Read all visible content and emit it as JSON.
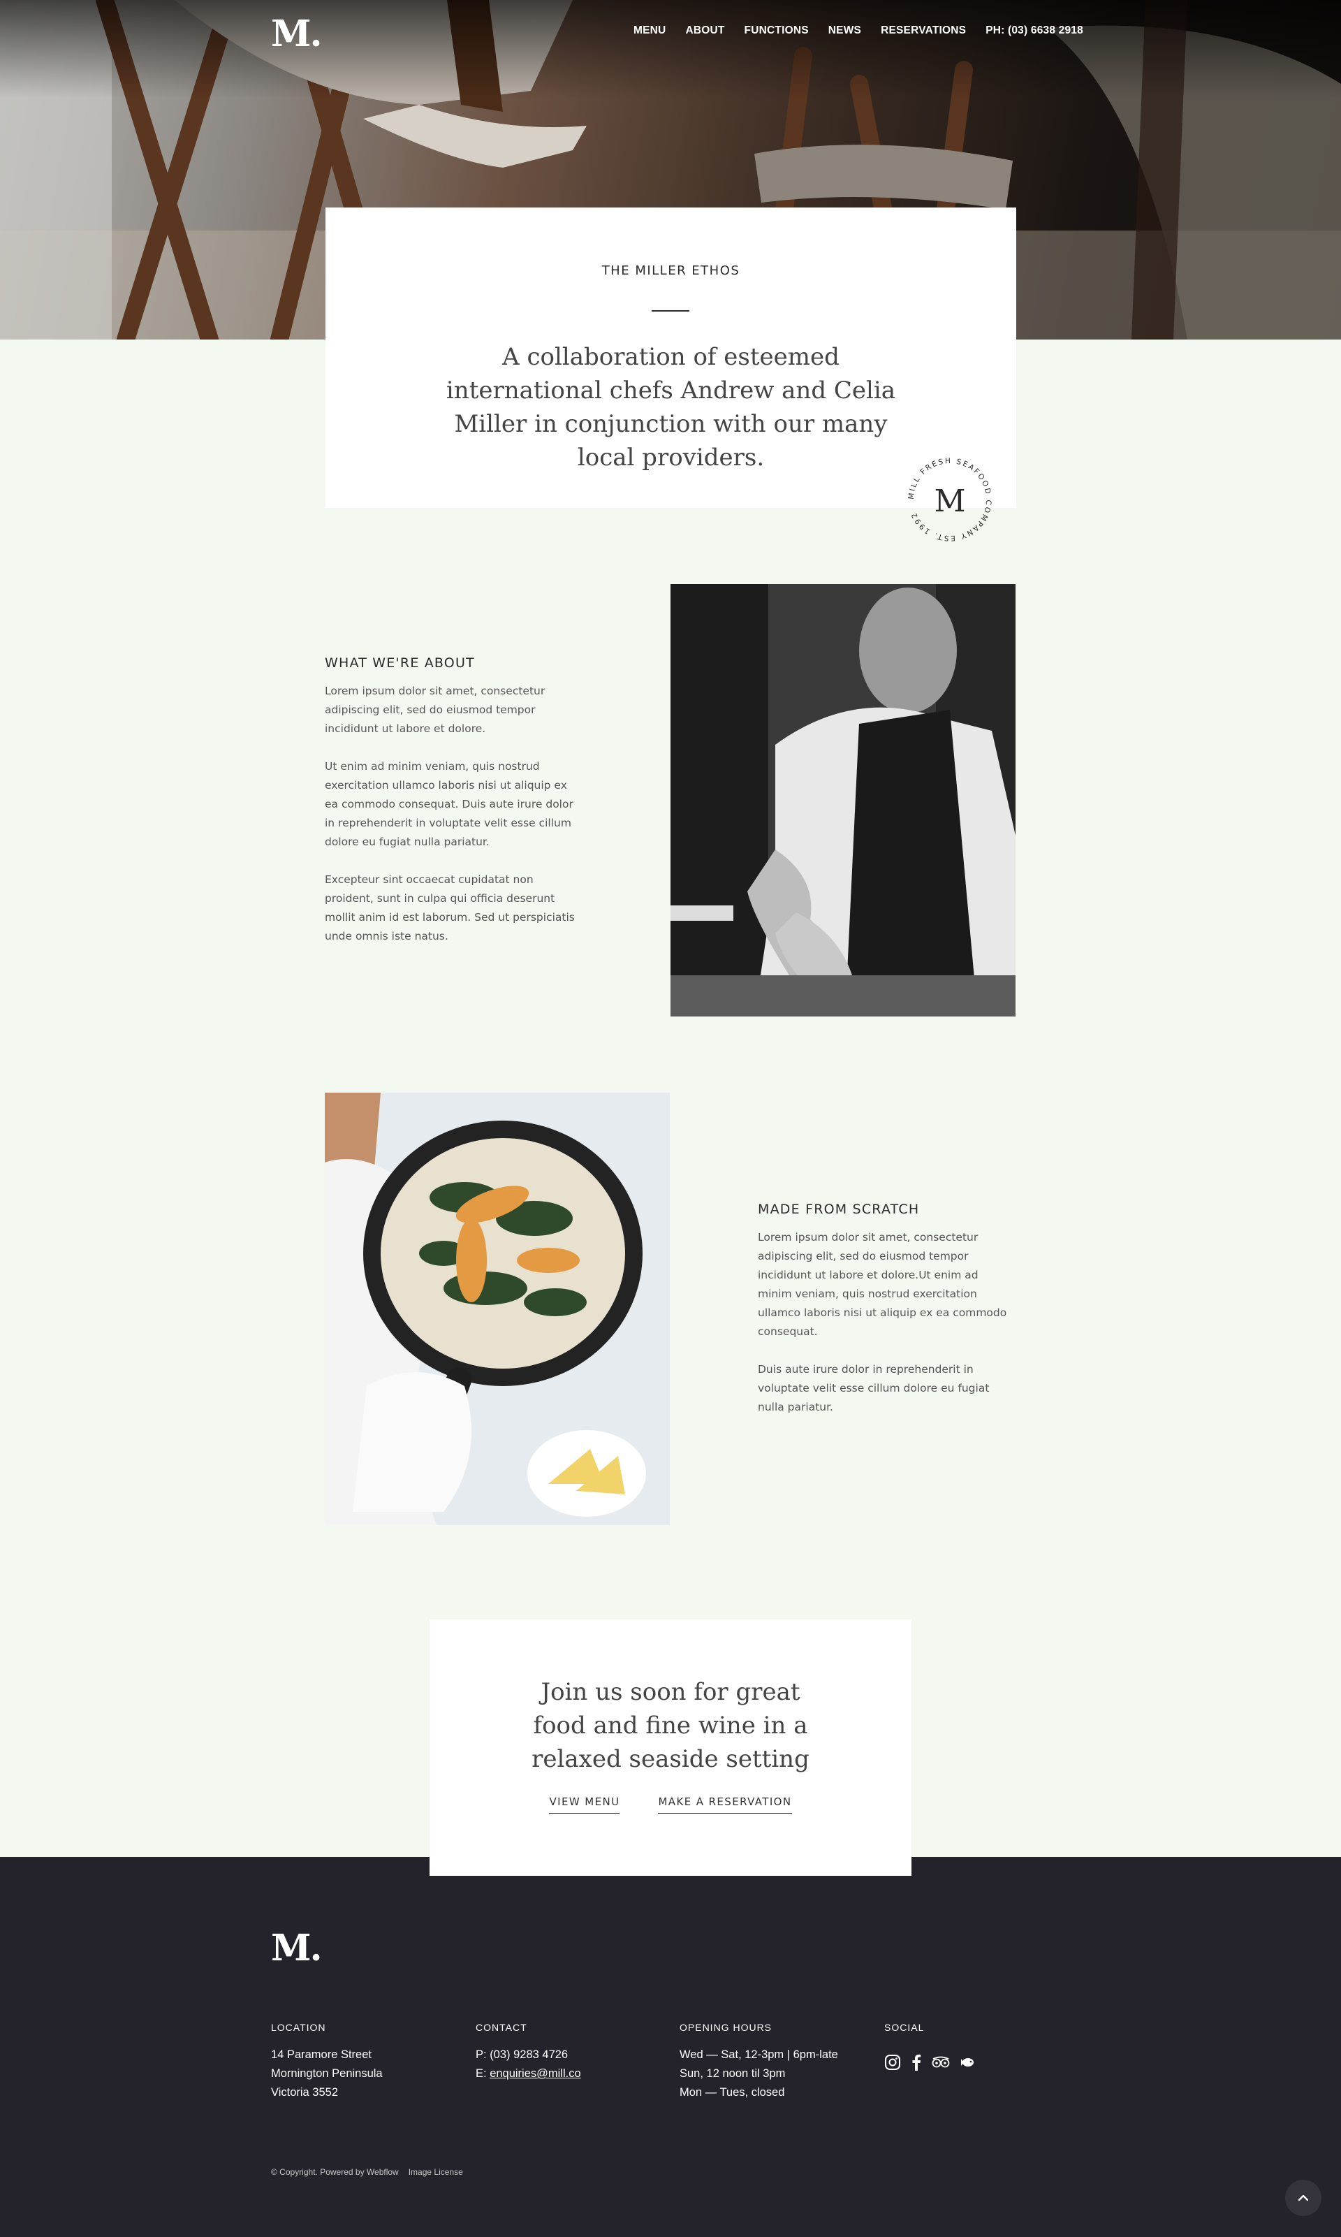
{
  "brand": {
    "logo_text": "M."
  },
  "nav": {
    "items": [
      "MENU",
      "ABOUT",
      "FUNCTIONS",
      "NEWS",
      "RESERVATIONS"
    ],
    "phone": "PH: (03) 6638 2918"
  },
  "ethos": {
    "kicker": "THE MILLER ETHOS",
    "quote": "A collaboration of esteemed international chefs Andrew and Celia Miller in conjunction with our many local providers."
  },
  "seal": {
    "ring_text": "MILL FRESH SEAFOOD COMPANY EST. 1992",
    "monogram": "M"
  },
  "about": {
    "heading": "WHAT WE'RE ABOUT",
    "paragraphs": [
      "Lorem ipsum dolor sit amet, consectetur adipiscing elit, sed do eiusmod tempor incididunt ut labore et dolore.",
      "Ut enim ad minim veniam, quis nostrud exercitation ullamco laboris nisi ut aliquip ex ea commodo consequat. Duis aute irure dolor in reprehenderit in voluptate velit esse cillum dolore eu fugiat nulla pariatur.",
      "Excepteur sint occaecat cupidatat non proident, sunt in culpa qui officia deserunt mollit anim id est laborum. Sed ut perspiciatis unde omnis iste natus."
    ]
  },
  "scratch": {
    "heading": "MADE FROM SCRATCH",
    "paragraphs": [
      "Lorem ipsum dolor sit amet, consectetur adipiscing elit, sed do eiusmod tempor incididunt ut labore et dolore.Ut enim ad minim veniam, quis nostrud exercitation ullamco laboris nisi ut aliquip ex ea commodo consequat.",
      "Duis aute irure dolor in reprehenderit in voluptate velit esse cillum dolore eu fugiat nulla pariatur."
    ]
  },
  "cta": {
    "title": "Join us soon for great food and fine wine in a relaxed seaside setting",
    "view_menu": "VIEW MENU",
    "reserve": "MAKE A RESERVATION"
  },
  "footer": {
    "logo_text": "M.",
    "location": {
      "title": "LOCATION",
      "lines": [
        "14 Paramore Street",
        "Mornington Peninsula",
        "Victoria 3552"
      ]
    },
    "contact": {
      "title": "CONTACT",
      "phone_prefix": "P: ",
      "phone": "(03) 9283 4726",
      "email_prefix": "E: ",
      "email": "enquiries@mill.co"
    },
    "hours": {
      "title": "OPENING HOURS",
      "lines": [
        "Wed — Sat, 12-3pm | 6pm-late",
        "Sun, 12 noon til 3pm",
        "Mon — Tues, closed"
      ]
    },
    "social": {
      "title": "SOCIAL",
      "icons": [
        "instagram-icon",
        "facebook-icon",
        "tripadvisor-icon",
        "zomato-icon"
      ]
    },
    "copyright": "© Copyright. Powered by Webflow",
    "image_license": "Image License"
  },
  "colors": {
    "background": "#f3f8f1",
    "footer": "#24232b",
    "text": "#2b2b2b"
  }
}
